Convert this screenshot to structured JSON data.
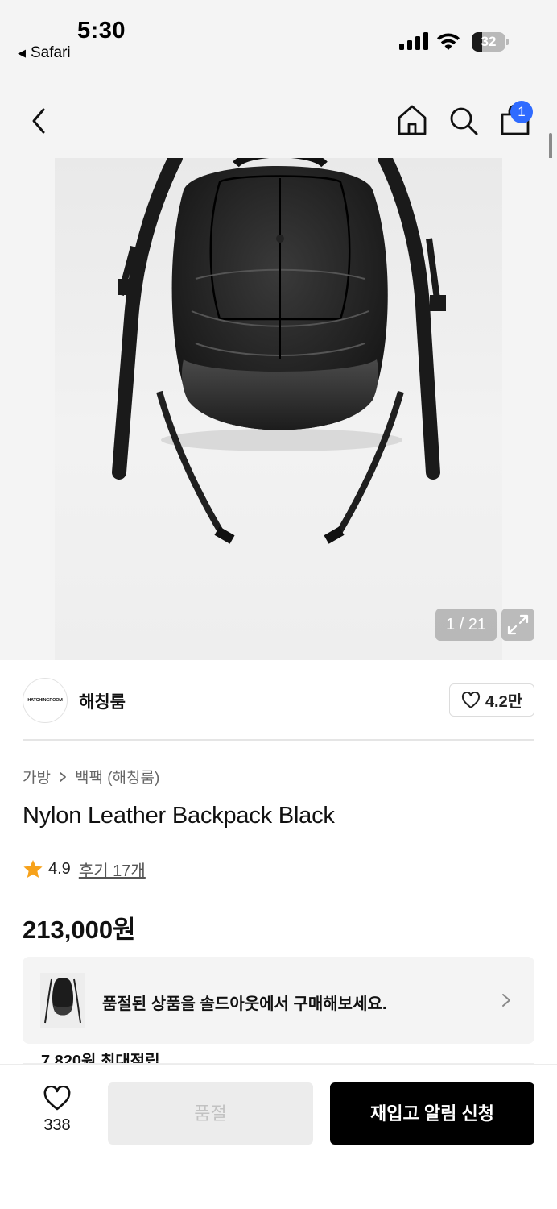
{
  "status_bar": {
    "time": "5:30",
    "back_app": "Safari",
    "battery": "32",
    "battery_level": 0.32
  },
  "nav": {
    "back_icon": "chevron-left-icon",
    "home_icon": "home-icon",
    "search_icon": "search-icon",
    "cart_icon": "shopping-bag-icon",
    "cart_badge": "1"
  },
  "gallery": {
    "counter": "1 / 21",
    "expand_icon": "expand-icon"
  },
  "brand": {
    "logo_text": "HATCHINGROOM",
    "name": "해칭룸",
    "likes": "4.2만",
    "like_icon": "heart-outline-icon"
  },
  "breadcrumb": {
    "category": "가방",
    "subcategory": "백팩 (해칭룸)"
  },
  "product": {
    "title": "Nylon Leather Backpack Black",
    "rating": "4.9",
    "reviews": "후기 17개",
    "price": "213,000원"
  },
  "soldout_banner": {
    "text": "품절된 상품을 솔드아웃에서 구매해보세요."
  },
  "points": {
    "text": "7,820원 최대적립"
  },
  "bottom_bar": {
    "wish_count": "338",
    "soldout_label": "품절",
    "restock_label": "재입고 알림 신청"
  },
  "colors": {
    "accent_badge": "#2f6bff",
    "star": "#f7a21b",
    "primary_button": "#000000"
  }
}
